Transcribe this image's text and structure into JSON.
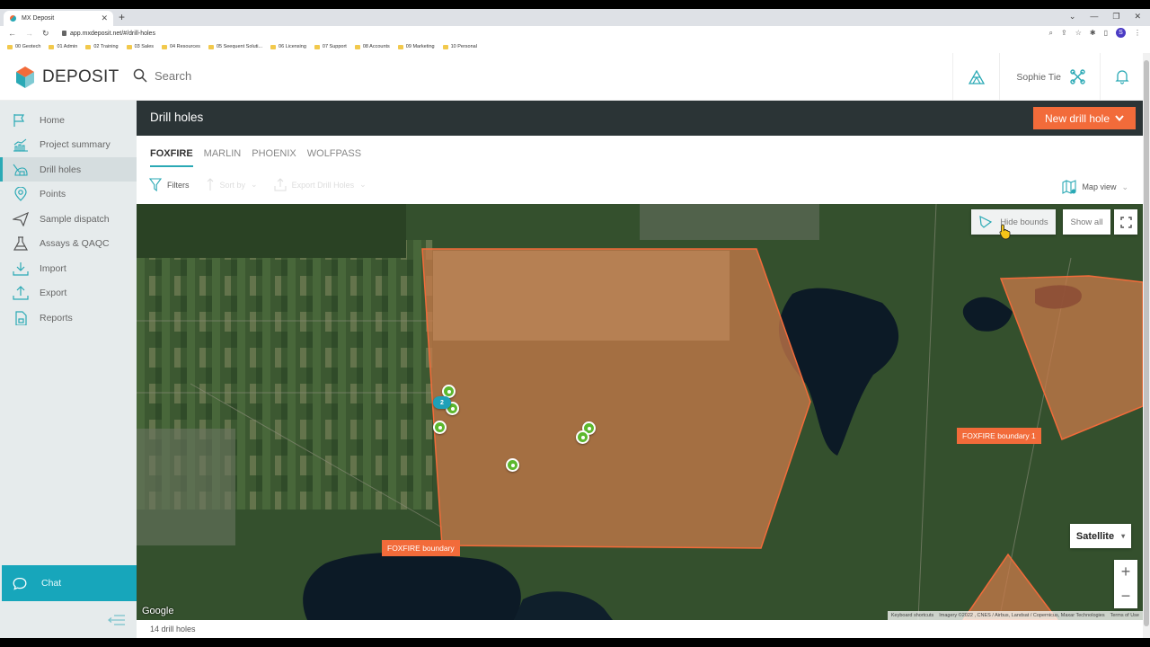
{
  "browser": {
    "tab_title": "MX Deposit",
    "url": "app.mxdeposit.net/#/drill-holes",
    "profile_initial": "S",
    "bookmarks": [
      "00 Geotech",
      "01 Admin",
      "02 Training",
      "03 Sales",
      "04 Resources",
      "05 Seequent Soluti...",
      "06 Licensing",
      "07 Support",
      "08 Accounts",
      "09 Marketing",
      "10 Personal"
    ]
  },
  "header": {
    "logo_text": "DEPOSIT",
    "search_placeholder": "Search",
    "user_name": "Sophie Tie"
  },
  "sidebar": {
    "items": [
      {
        "label": "Home",
        "icon": "flag-icon"
      },
      {
        "label": "Project summary",
        "icon": "chart-icon"
      },
      {
        "label": "Drill holes",
        "icon": "drill-icon",
        "active": true
      },
      {
        "label": "Points",
        "icon": "map-pin-icon"
      },
      {
        "label": "Sample dispatch",
        "icon": "send-icon"
      },
      {
        "label": "Assays & QAQC",
        "icon": "flask-icon"
      },
      {
        "label": "Import",
        "icon": "import-icon"
      },
      {
        "label": "Export",
        "icon": "export-icon"
      },
      {
        "label": "Reports",
        "icon": "report-icon"
      }
    ],
    "chat_label": "Chat"
  },
  "main": {
    "title": "Drill holes",
    "new_button": "New drill hole",
    "project_tabs": [
      {
        "label": "FOXFIRE",
        "active": true
      },
      {
        "label": "MARLIN"
      },
      {
        "label": "PHOENIX"
      },
      {
        "label": "WOLFPASS"
      }
    ],
    "toolbar": {
      "filters": "Filters",
      "sort_by": "Sort by",
      "export": "Export Drill Holes",
      "view": "Map view"
    }
  },
  "map": {
    "hide_bounds": "Hide bounds",
    "show_all": "Show all",
    "map_type": "Satellite",
    "zoom_in": "+",
    "zoom_out": "−",
    "boundary_labels": [
      "FOXFIRE boundary",
      "FOXFIRE boundary 1"
    ],
    "cluster_count": "2",
    "google_label": "Google",
    "attribution": {
      "shortcuts": "Keyboard shortcuts",
      "imagery": "Imagery ©2022 , CNES / Airbus, Landsat / Copernicus, Maxar Technologies",
      "terms": "Terms of Use"
    },
    "colors": {
      "boundary_fill": "#c97a4a",
      "boundary_stroke": "#f26b3a",
      "marker": "#5cb82e",
      "cluster": "#1ea0b8"
    }
  },
  "footer": {
    "count_text": "14 drill holes"
  },
  "colors": {
    "accent": "#2aa9b5",
    "primary_button": "#f26b3a",
    "titlebar": "#2b3436",
    "chat": "#17a6bb"
  }
}
